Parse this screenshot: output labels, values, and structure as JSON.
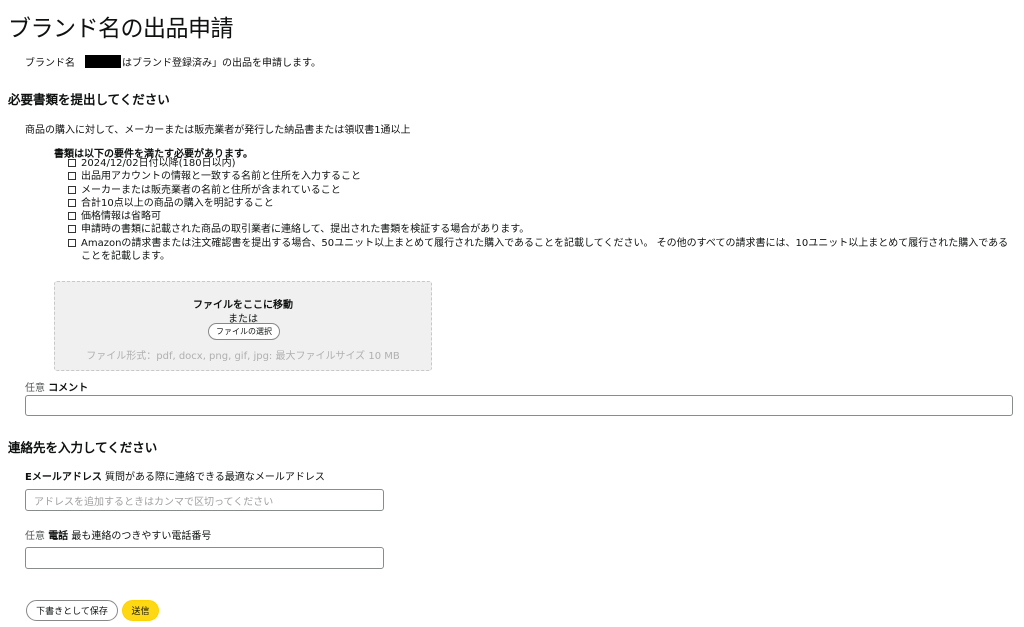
{
  "page": {
    "title": "ブランド名の出品申請",
    "intro_prefix": "ブランド名",
    "intro_suffix": "はブランド登録済み」の出品を申請します。"
  },
  "documents": {
    "section_title": "必要書類を提出してください",
    "description": "商品の購入に対して、メーカーまたは販売業者が発行した納品書または領収書1通以上",
    "requirements_heading": "書類は以下の要件を満たす必要があります。",
    "requirements": [
      "2024/12/02日付以降(180日以内)",
      "出品用アカウントの情報と一致する名前と住所を入力すること",
      "メーカーまたは販売業者の名前と住所が含まれていること",
      "合計10点以上の商品の購入を明記すること",
      "価格情報は省略可",
      "申請時の書類に記載された商品の取引業者に連絡して、提出された書類を検証する場合があります。",
      "Amazonの請求書または注文確認書を提出する場合、50ユニット以上まとめて履行された購入であることを記載してください。 その他のすべての請求書には、10ユニット以上まとめて履行された購入であることを記載します。"
    ],
    "dropzone": {
      "title": "ファイルをここに移動",
      "or": "または",
      "choose_button": "ファイルの選択",
      "formats": "ファイル形式：pdf, docx, png, gif, jpg: 最大ファイルサイズ 10 MB"
    },
    "comment": {
      "optional": "任意",
      "label": "コメント",
      "value": ""
    }
  },
  "contact": {
    "section_title": "連絡先を入力してください",
    "email": {
      "label": "Eメールアドレス",
      "hint": "質問がある際に連絡できる最適なメールアドレス",
      "placeholder": "アドレスを追加するときはカンマで区切ってください"
    },
    "phone": {
      "optional": "任意",
      "label": "電話",
      "hint": "最も連絡のつきやすい電話番号",
      "value": ""
    }
  },
  "actions": {
    "save_draft": "下書きとして保存",
    "submit": "送信"
  },
  "colors": {
    "submit_bg": "#ffd814",
    "text": "#0f1111",
    "muted": "#565959",
    "dropzone_bg": "#f0f0f0"
  }
}
